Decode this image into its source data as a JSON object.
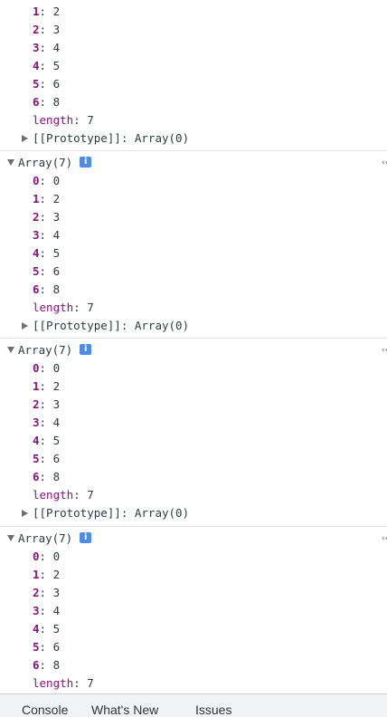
{
  "header": "Array(7)",
  "prototype_text": "[[Prototype]]: Array(0)",
  "info_glyph": "i",
  "src_glyph": "‹‹",
  "separator": ": ",
  "length_label": "length",
  "length_value": "7",
  "tabs": [
    "Console",
    "What's New",
    "Issues"
  ],
  "partial_group": {
    "entries": [
      {
        "key": "1",
        "value": "2"
      },
      {
        "key": "2",
        "value": "3"
      },
      {
        "key": "3",
        "value": "4"
      },
      {
        "key": "4",
        "value": "5"
      },
      {
        "key": "5",
        "value": "6"
      },
      {
        "key": "6",
        "value": "8"
      }
    ]
  },
  "full_entries": [
    {
      "key": "0",
      "value": "0"
    },
    {
      "key": "1",
      "value": "2"
    },
    {
      "key": "2",
      "value": "3"
    },
    {
      "key": "3",
      "value": "4"
    },
    {
      "key": "4",
      "value": "5"
    },
    {
      "key": "5",
      "value": "6"
    },
    {
      "key": "6",
      "value": "8"
    }
  ]
}
